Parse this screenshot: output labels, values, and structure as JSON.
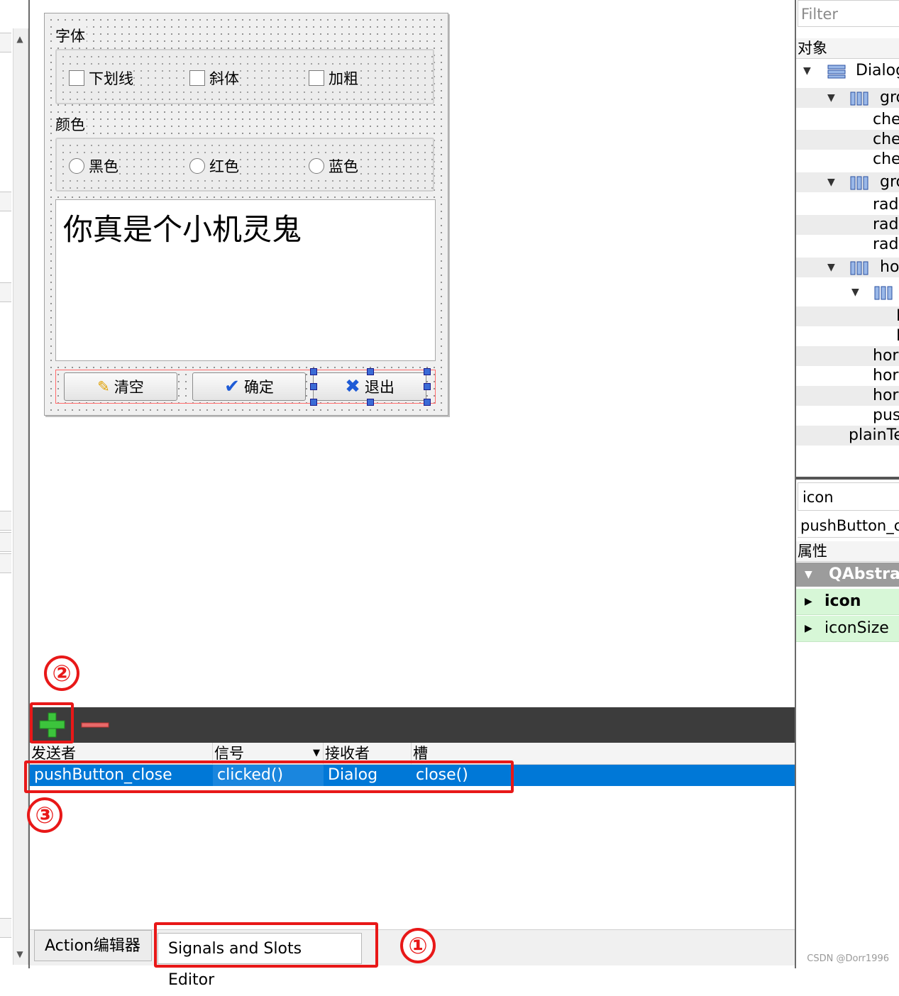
{
  "form": {
    "font_group_title": "字体",
    "underline_label": "下划线",
    "italic_label": "斜体",
    "bold_label": "加粗",
    "color_group_title": "颜色",
    "black_label": "黑色",
    "red_label": "红色",
    "blue_label": "蓝色",
    "plain_text": "你真是个小机灵鬼",
    "clear_button": "清空",
    "ok_button": "确定",
    "exit_button": "退出"
  },
  "object_inspector": {
    "filter_placeholder": "Filter",
    "header": "对象",
    "rows": [
      {
        "text": "Dialog",
        "icon": "vertical-layout-icon"
      },
      {
        "text": "gro",
        "icon": "horizontal-layout-icon"
      },
      {
        "text": "che"
      },
      {
        "text": "che"
      },
      {
        "text": "che"
      },
      {
        "text": "gro",
        "icon": "horizontal-layout-icon"
      },
      {
        "text": "radi"
      },
      {
        "text": "radi"
      },
      {
        "text": "radi"
      },
      {
        "text": "ho",
        "icon": "horizontal-layout-icon"
      },
      {
        "text": "",
        "icon": "horizontal-layout-icon"
      },
      {
        "text": "I"
      },
      {
        "text": "I"
      },
      {
        "text": "hor"
      },
      {
        "text": "hor"
      },
      {
        "text": "hor"
      },
      {
        "text": "pus"
      },
      {
        "text": "plainTe"
      }
    ]
  },
  "property_editor": {
    "filter_value": "icon",
    "object_name": "pushButton_c",
    "header": "属性",
    "group": "QAbstrac",
    "props": [
      "icon",
      "iconSize"
    ]
  },
  "signals_slots": {
    "columns": [
      "发送者",
      "信号",
      "接收者",
      "槽"
    ],
    "rows": [
      {
        "sender": "pushButton_close",
        "signal": "clicked()",
        "receiver": "Dialog",
        "slot": "close()"
      }
    ]
  },
  "tabs": [
    "Action编辑器",
    "Signals and Slots Editor"
  ],
  "annotations": [
    "①",
    "②",
    "③"
  ],
  "watermark": "CSDN @Dorr1996",
  "colors": {
    "selection": "#0078d7",
    "annotation": "#e81818",
    "property_highlight": "#d7f7d7"
  }
}
